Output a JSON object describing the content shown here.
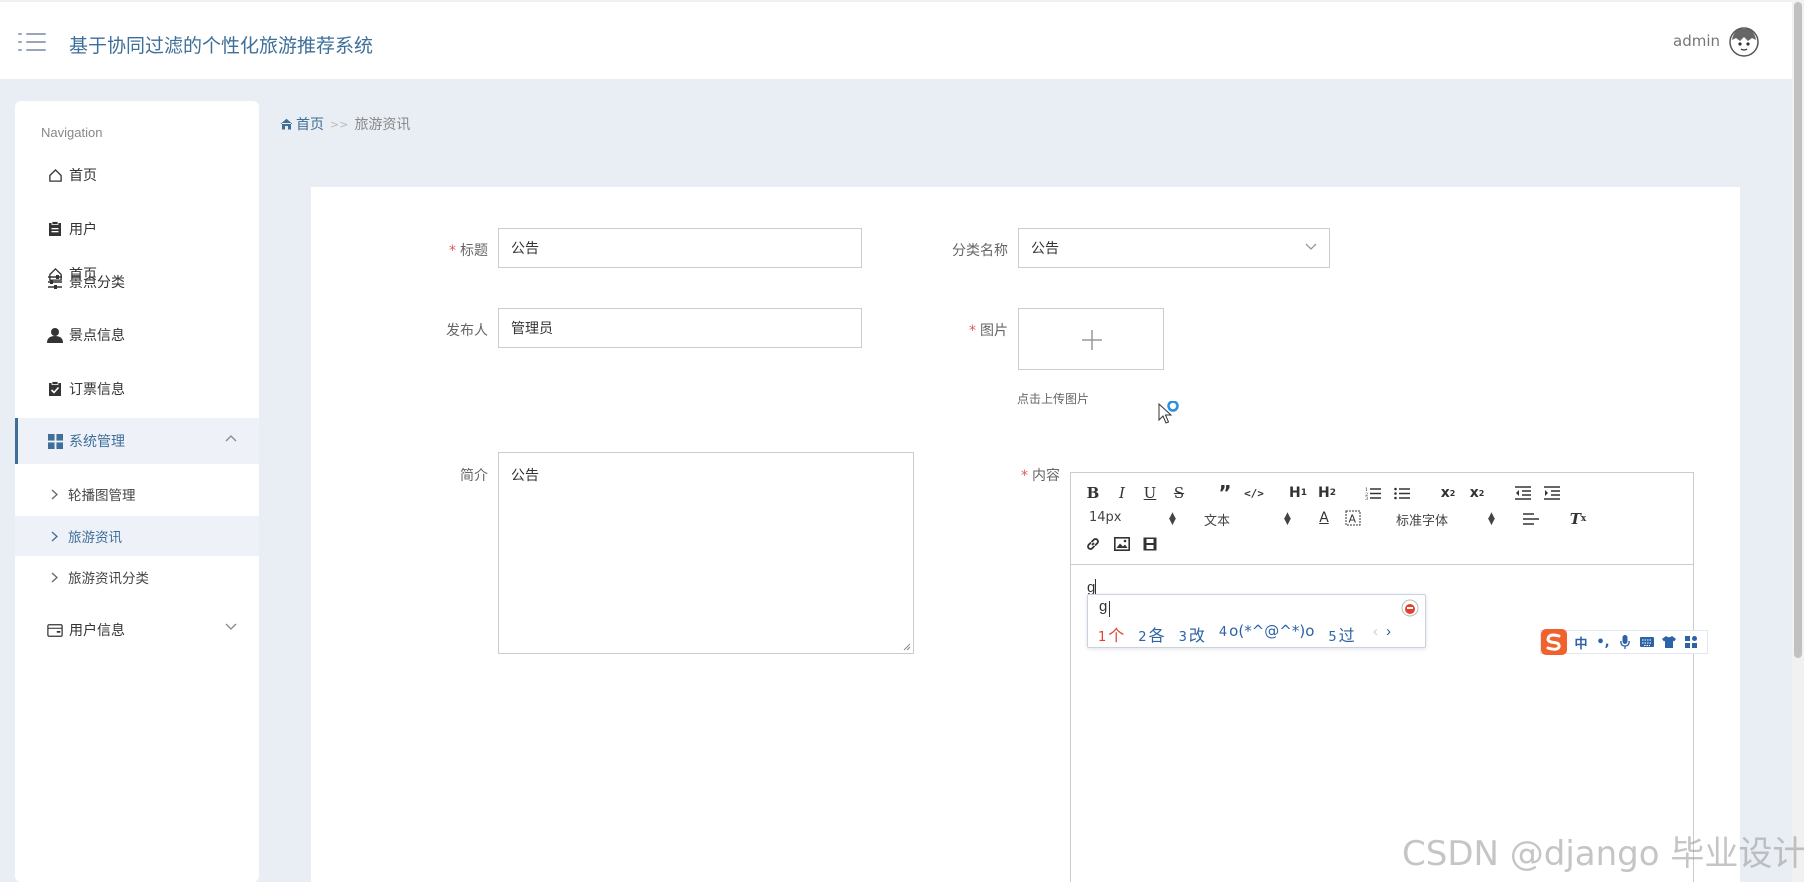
{
  "header": {
    "app_title": "基于协同过滤的个性化旅游推荐系统",
    "username": "admin",
    "menu_icon": "hamburger-menu-icon",
    "avatar_icon": "user-avatar-icon"
  },
  "sidebar": {
    "caption": "Navigation",
    "items": [
      {
        "label": "首页",
        "icon": "home-icon"
      },
      {
        "label": "用户",
        "icon": "clipboard-icon"
      },
      {
        "label": "景点分类",
        "icon": "sliders-icon"
      },
      {
        "label": "景点信息",
        "icon": "person-icon"
      },
      {
        "label": "订票信息",
        "icon": "clipboard-check-icon"
      },
      {
        "label": "系统管理",
        "icon": "grid-icon",
        "expanded": true
      },
      {
        "label": "用户信息",
        "icon": "wallet-icon",
        "expanded": false
      }
    ],
    "subitems": [
      {
        "label": "轮播图管理"
      },
      {
        "label": "旅游资讯",
        "active": true
      },
      {
        "label": "旅游资讯分类"
      }
    ]
  },
  "breadcrumb": {
    "home": "首页",
    "separator": ">>",
    "current": "旅游资讯"
  },
  "form": {
    "title_label": "标题",
    "title_value": "公告",
    "category_label": "分类名称",
    "category_value": "公告",
    "publisher_label": "发布人",
    "publisher_value": "管理员",
    "image_label": "图片",
    "upload_hint": "点击上传图片",
    "summary_label": "简介",
    "summary_value": "公告",
    "content_label": "内容"
  },
  "editor": {
    "font_size": "14px",
    "header_select": "文本",
    "font_family": "标准字体",
    "body_text": "g"
  },
  "ime": {
    "input": "g",
    "candidates": [
      {
        "num": "1",
        "text": "个"
      },
      {
        "num": "2",
        "text": "各"
      },
      {
        "num": "3",
        "text": "改"
      },
      {
        "num": "4",
        "text": "o(*^@^*)o"
      },
      {
        "num": "5",
        "text": "过"
      }
    ],
    "bar_mode": "中",
    "bar_punct": "•,"
  },
  "watermark": "CSDN @django 毕业设计",
  "colors": {
    "accent": "#3e6f99",
    "required": "#e45656",
    "ime_red": "#e0412f",
    "ime_blue": "#2d63a6"
  }
}
